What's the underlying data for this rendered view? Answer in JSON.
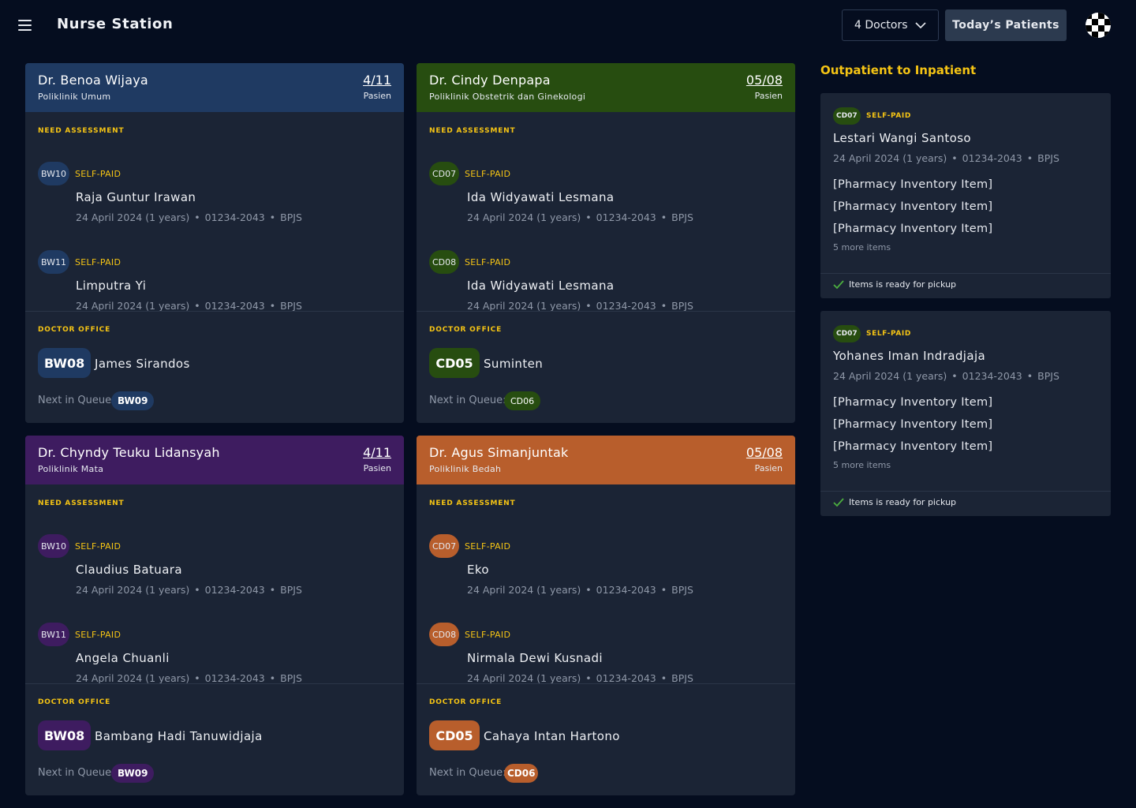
{
  "header": {
    "title": "Nurse Station",
    "doctors_select": "4 Doctors",
    "today_button": "Today’s Patients"
  },
  "labels": {
    "need_assessment": "NEED ASSESSMENT",
    "doctor_office": "DOCTOR OFFICE",
    "next_in_queue": "Next in Queue:",
    "pasien": "Pasien",
    "dot": "•"
  },
  "colors": {
    "background": "#050d1f",
    "card": "#1b2435",
    "accent_yellow": "#f5c414",
    "blue": "#1f3a62",
    "green": "#274d10",
    "purple": "#3e1c60",
    "orange": "#b85e2c"
  },
  "cards": [
    {
      "doctor": "Dr. Benoa Wijaya",
      "poli": "Poliklinik Umum",
      "count": "4/11",
      "assessments": [
        {
          "code": "BW10",
          "payment": "SELF-PAID",
          "name": "Raja Guntur Irawan",
          "date": "24 April 2024 (1 years)",
          "id": "01234-2043",
          "insurance": "BPJS"
        },
        {
          "code": "BW11",
          "payment": "SELF-PAID",
          "name": "Limputra Yi",
          "date": "24 April 2024 (1 years)",
          "id": "01234-2043",
          "insurance": "BPJS"
        }
      ],
      "office": {
        "code": "BW08",
        "name": "James Sirandos"
      },
      "next_queue": "BW09"
    },
    {
      "doctor": "Dr. Cindy Denpapa",
      "poli": "Poliklinik Obstetrik dan Ginekologi",
      "count": "05/08",
      "assessments": [
        {
          "code": "CD07",
          "payment": "SELF-PAID",
          "name": "Ida Widyawati Lesmana",
          "date": "24 April 2024 (1 years)",
          "id": "01234-2043",
          "insurance": "BPJS"
        },
        {
          "code": "CD08",
          "payment": "SELF-PAID",
          "name": "Ida Widyawati Lesmana",
          "date": "24 April 2024 (1 years)",
          "id": "01234-2043",
          "insurance": "BPJS"
        }
      ],
      "office": {
        "code": "CD05",
        "name": "Suminten"
      },
      "next_queue": "CD06"
    },
    {
      "doctor": "Dr. Chyndy Teuku Lidansyah",
      "poli": "Poliklinik Mata",
      "count": "4/11",
      "assessments": [
        {
          "code": "BW10",
          "payment": "SELF-PAID",
          "name": "Claudius Batuara",
          "date": "24 April 2024 (1 years)",
          "id": "01234-2043",
          "insurance": "BPJS"
        },
        {
          "code": "BW11",
          "payment": "SELF-PAID",
          "name": "Angela Chuanli",
          "date": "24 April 2024 (1 years)",
          "id": "01234-2043",
          "insurance": "BPJS"
        }
      ],
      "office": {
        "code": "BW08",
        "name": "Bambang Hadi Tanuwidjaja"
      },
      "next_queue": "BW09"
    },
    {
      "doctor": "Dr. Agus Simanjuntak",
      "poli": "Poliklinik Bedah",
      "count": "05/08",
      "assessments": [
        {
          "code": "CD07",
          "payment": "SELF-PAID",
          "name": "Eko",
          "date": "24 April 2024 (1 years)",
          "id": "01234-2043",
          "insurance": "BPJS"
        },
        {
          "code": "CD08",
          "payment": "SELF-PAID",
          "name": "Nirmala Dewi Kusnadi",
          "date": "24 April 2024 (1 years)",
          "id": "01234-2043",
          "insurance": "BPJS"
        }
      ],
      "office": {
        "code": "CD05",
        "name": "Cahaya Intan Hartono"
      },
      "next_queue": "CD06"
    }
  ],
  "outpatient": {
    "title": "Outpatient to Inpatient",
    "items": [
      {
        "code": "CD07",
        "payment": "SELF-PAID",
        "name": "Lestari Wangi Santoso",
        "date": "24 April 2024 (1 years)",
        "id": "01234-2043",
        "insurance": "BPJS",
        "pharmacy": [
          "[Pharmacy Inventory Item]",
          "[Pharmacy Inventory Item]",
          "[Pharmacy Inventory Item]"
        ],
        "more": "5 more items",
        "status": "Items is ready for pickup"
      },
      {
        "code": "CD07",
        "payment": "SELF-PAID",
        "name": "Yohanes Iman Indradjaja",
        "date": "24 April 2024 (1 years)",
        "id": "01234-2043",
        "insurance": "BPJS",
        "pharmacy": [
          "[Pharmacy Inventory Item]",
          "[Pharmacy Inventory Item]",
          "[Pharmacy Inventory Item]"
        ],
        "more": "5 more items",
        "status": "Items is ready for pickup"
      }
    ]
  }
}
